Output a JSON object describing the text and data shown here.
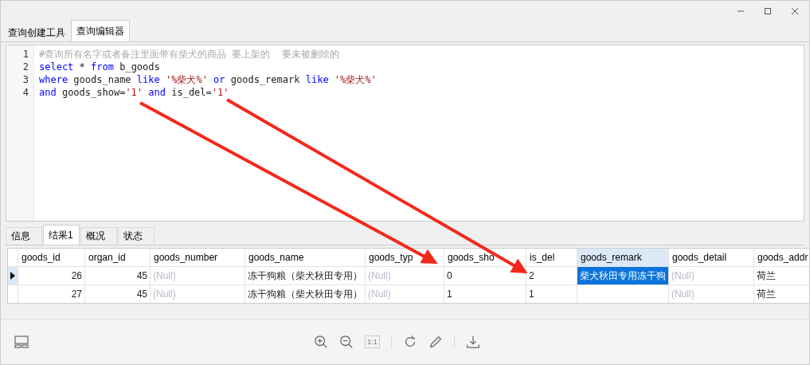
{
  "tabs": [
    {
      "label": "查询创建工具",
      "selected": false
    },
    {
      "label": "查询编辑器",
      "selected": true
    }
  ],
  "editor": {
    "lines": [
      {
        "number": "1",
        "tokens": [
          {
            "kind": "comment",
            "text": "#查询所有名字或者备注里面带有柴犬的商品 要上架的  要未被删除的"
          }
        ]
      },
      {
        "number": "2",
        "tokens": [
          {
            "kind": "keyword",
            "text": "select"
          },
          {
            "kind": "plain",
            "text": " * "
          },
          {
            "kind": "keyword",
            "text": "from"
          },
          {
            "kind": "plain",
            "text": " b_goods"
          }
        ]
      },
      {
        "number": "3",
        "tokens": [
          {
            "kind": "keyword",
            "text": "where"
          },
          {
            "kind": "plain",
            "text": " goods_name "
          },
          {
            "kind": "keyword",
            "text": "like"
          },
          {
            "kind": "string",
            "text": " '%柴犬%' "
          },
          {
            "kind": "keyword",
            "text": "or"
          },
          {
            "kind": "plain",
            "text": " goods_remark "
          },
          {
            "kind": "keyword",
            "text": "like"
          },
          {
            "kind": "string",
            "text": " '%柴犬%'"
          }
        ]
      },
      {
        "number": "4",
        "tokens": [
          {
            "kind": "keyword",
            "text": "and"
          },
          {
            "kind": "plain",
            "text": " goods_show="
          },
          {
            "kind": "string",
            "text": "'1'"
          },
          {
            "kind": "keyword",
            "text": " and"
          },
          {
            "kind": "plain",
            "text": " is_del="
          },
          {
            "kind": "string",
            "text": "'1'"
          }
        ]
      }
    ]
  },
  "result_tabs": [
    {
      "label": "信息",
      "selected": false
    },
    {
      "label": "结果1",
      "selected": true
    },
    {
      "label": "概况",
      "selected": false
    },
    {
      "label": "状态",
      "selected": false
    }
  ],
  "table": {
    "columns": [
      {
        "label": "goods_id",
        "selected": false
      },
      {
        "label": "organ_id",
        "selected": false
      },
      {
        "label": "goods_number",
        "selected": false
      },
      {
        "label": "goods_name",
        "selected": false
      },
      {
        "label": "goods_typ",
        "selected": false
      },
      {
        "label": "goods_sho",
        "selected": false
      },
      {
        "label": "is_del",
        "selected": false
      },
      {
        "label": "goods_remark",
        "selected": true
      },
      {
        "label": "goods_detail",
        "selected": false
      },
      {
        "label": "goods_addr",
        "selected": false
      }
    ],
    "rows": [
      {
        "selected": true,
        "cells": [
          {
            "kind": "number",
            "text": "26",
            "selected": false
          },
          {
            "kind": "number",
            "text": "45",
            "selected": false
          },
          {
            "kind": "null",
            "text": "(Null)",
            "selected": false
          },
          {
            "kind": "text",
            "text": "冻干狗粮（柴犬秋田专用）",
            "selected": false
          },
          {
            "kind": "null",
            "text": "(Null)",
            "selected": false
          },
          {
            "kind": "text",
            "text": "0",
            "selected": false
          },
          {
            "kind": "text",
            "text": "2",
            "selected": false
          },
          {
            "kind": "text",
            "text": "柴犬秋田专用冻干狗",
            "selected": true
          },
          {
            "kind": "null",
            "text": "(Null)",
            "selected": false
          },
          {
            "kind": "text",
            "text": "荷兰",
            "selected": false
          }
        ]
      },
      {
        "selected": false,
        "cells": [
          {
            "kind": "number",
            "text": "27",
            "selected": false
          },
          {
            "kind": "number",
            "text": "45",
            "selected": false
          },
          {
            "kind": "null",
            "text": "(Null)",
            "selected": false
          },
          {
            "kind": "text",
            "text": "冻干狗粮（柴犬秋田专用）",
            "selected": false
          },
          {
            "kind": "null",
            "text": "(Null)",
            "selected": false
          },
          {
            "kind": "text",
            "text": "1",
            "selected": false
          },
          {
            "kind": "text",
            "text": "1",
            "selected": false
          },
          {
            "kind": "empty",
            "selected": false
          },
          {
            "kind": "null",
            "text": "(Null)",
            "selected": false
          },
          {
            "kind": "text",
            "text": "荷兰",
            "selected": false
          }
        ]
      }
    ]
  },
  "viewer_toolbar": {
    "ratio_label": "1:1"
  }
}
